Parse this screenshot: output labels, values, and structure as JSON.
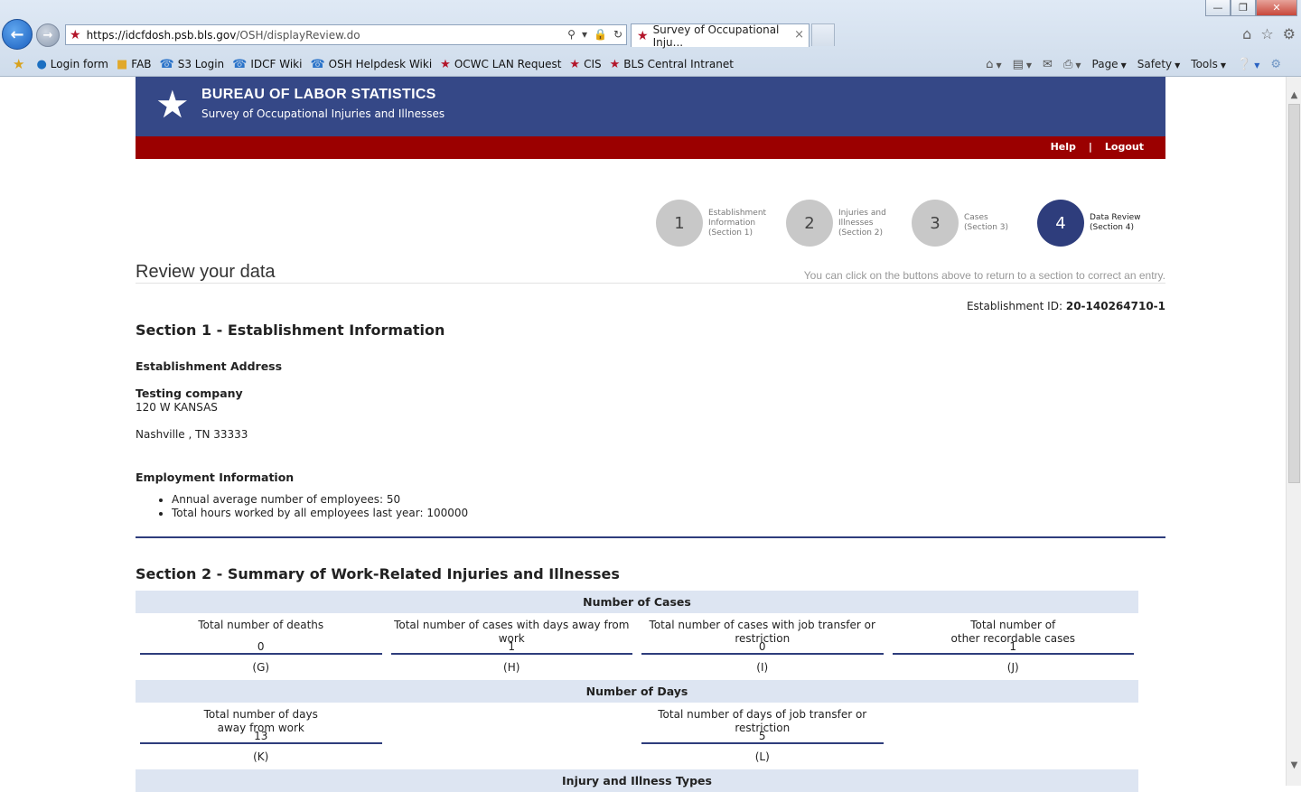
{
  "browser": {
    "url_host": "https://idcfdosh.psb.bls.gov",
    "url_path": "/OSH/displayReview.do",
    "tab_title": "Survey of Occupational Inju...",
    "tab_close": "×",
    "window_controls": [
      "—",
      "❐",
      "✕"
    ],
    "favorites": [
      {
        "label": "Login form",
        "icon": "globe-icon"
      },
      {
        "label": "FAB",
        "icon": "folder-icon"
      },
      {
        "label": "S3 Login",
        "icon": "ie-icon"
      },
      {
        "label": "IDCF Wiki",
        "icon": "ie-icon"
      },
      {
        "label": "OSH Helpdesk Wiki",
        "icon": "ie-icon"
      },
      {
        "label": "OCWC LAN Request",
        "icon": "star-icon"
      },
      {
        "label": "CIS",
        "icon": "star-icon"
      },
      {
        "label": "BLS Central Intranet",
        "icon": "star-icon"
      }
    ],
    "commands": [
      "Page",
      "Safety",
      "Tools"
    ]
  },
  "header": {
    "org": "BUREAU OF LABOR STATISTICS",
    "subtitle": "Survey of Occupational Injuries and Illnesses",
    "help": "Help",
    "separator": "|",
    "logout": "Logout"
  },
  "steps": [
    {
      "number": "1",
      "label": "Establishment\nInformation\n(Section 1)",
      "active": false
    },
    {
      "number": "2",
      "label": "Injuries and\nIllnesses\n(Section 2)",
      "active": false
    },
    {
      "number": "3",
      "label": "Cases\n(Section 3)",
      "active": false
    },
    {
      "number": "4",
      "label": "Data Review\n(Section 4)",
      "active": true
    }
  ],
  "review": {
    "title": "Review your data",
    "hint": "You can click on the buttons above to return to a section to correct an entry.",
    "estab_id_label": "Establishment ID:",
    "estab_id_value": "20-140264710-1"
  },
  "section1": {
    "title": "Section 1 - Establishment Information",
    "address_heading": "Establishment Address",
    "company": "Testing company",
    "street": "120 W KANSAS",
    "city_line": "Nashville , TN 33333",
    "employment_heading": "Employment Information",
    "employment_items": [
      "Annual average number of employees: 50",
      "Total hours worked by all employees last year: 100000"
    ]
  },
  "section2": {
    "title": "Section 2 - Summary of Work-Related Injuries and Illnesses",
    "cases_band": "Number of Cases",
    "cases": [
      {
        "label": "Total number of deaths",
        "value": "0",
        "code": "(G)"
      },
      {
        "label": "Total number of cases with days away from\nwork",
        "value": "1",
        "code": "(H)"
      },
      {
        "label": "Total number of cases with job transfer or\nrestriction",
        "value": "0",
        "code": "(I)"
      },
      {
        "label": "Total number of\nother recordable cases",
        "value": "1",
        "code": "(J)"
      }
    ],
    "days_band": "Number of Days",
    "days": [
      {
        "label": "Total number of days\naway from work",
        "value": "13",
        "code": "(K)"
      },
      {
        "label": "Total number of days of job transfer or\nrestriction",
        "value": "5",
        "code": "(L)"
      }
    ],
    "types_band": "Injury and Illness Types"
  }
}
